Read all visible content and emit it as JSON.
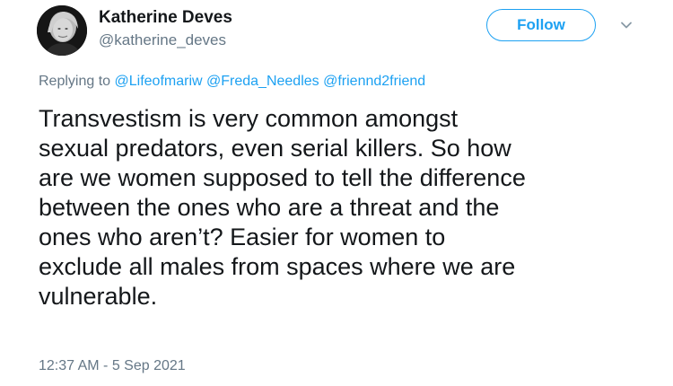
{
  "author": {
    "display_name": "Katherine Deves",
    "handle": "@katherine_deves"
  },
  "follow_label": "Follow",
  "reply": {
    "prefix": "Replying to",
    "mentions": [
      "@Lifeofmariw",
      "@Freda_Needles",
      "@friennd2friend"
    ]
  },
  "tweet": {
    "lines": [
      "Transvestism is very common amongst",
      "sexual predators, even serial killers. So how",
      "are we women supposed to tell the difference",
      "between the ones who are a threat and the",
      "ones who aren’t? Easier for women to",
      "exclude all males from spaces where we are",
      "vulnerable."
    ]
  },
  "timestamp": "12:37 AM - 5 Sep 2021",
  "colors": {
    "accent": "#1da1f2",
    "muted": "#657786",
    "text": "#14171a"
  },
  "icons": {
    "more": "chevron-down-icon"
  }
}
